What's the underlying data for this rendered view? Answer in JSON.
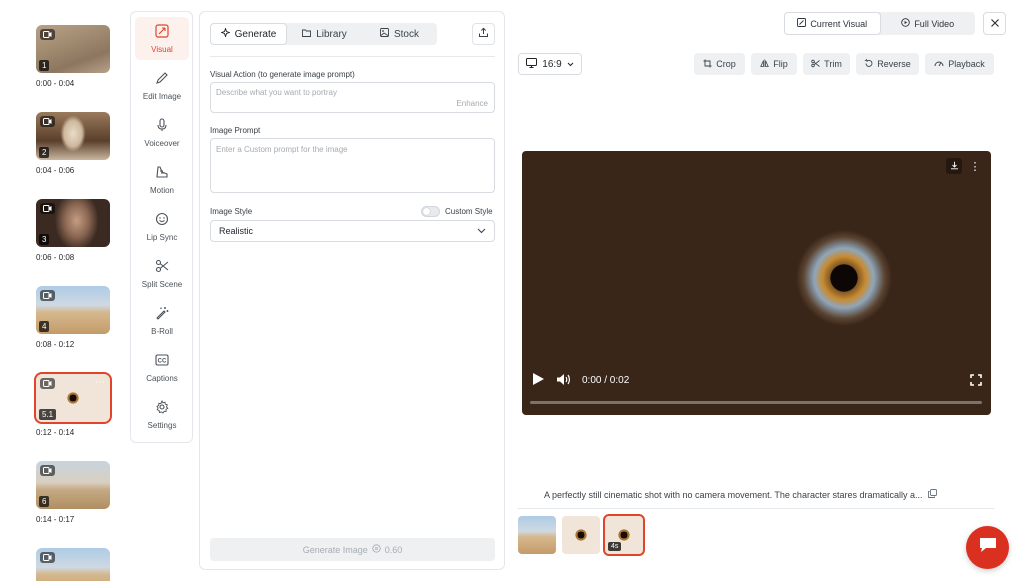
{
  "scenes": [
    {
      "number": "1",
      "time": "0:00 - 0:04",
      "image": "desert-woman-walking",
      "selected": false
    },
    {
      "number": "2",
      "time": "0:04 - 0:06",
      "image": "woman-portrait",
      "selected": false
    },
    {
      "number": "3",
      "time": "0:06 - 0:08",
      "image": "woman-face-closeup",
      "selected": false
    },
    {
      "number": "4",
      "time": "0:08 - 0:12",
      "image": "woman-in-dunes",
      "selected": false
    },
    {
      "number": "5.1",
      "time": "0:12 - 0:14",
      "image": "eye-closeup",
      "selected": true
    },
    {
      "number": "6",
      "time": "0:14 - 0:17",
      "image": "sand-dunes",
      "selected": false
    }
  ],
  "tools": [
    {
      "label": "Visual",
      "icon": "crop-frame-icon",
      "active": true
    },
    {
      "label": "Edit Image",
      "icon": "pencil-icon",
      "active": false
    },
    {
      "label": "Voiceover",
      "icon": "microphone-icon",
      "active": false
    },
    {
      "label": "Motion",
      "icon": "motion-icon",
      "active": false
    },
    {
      "label": "Lip Sync",
      "icon": "smile-icon",
      "active": false
    },
    {
      "label": "Split Scene",
      "icon": "scissors-icon",
      "active": false
    },
    {
      "label": "B-Roll",
      "icon": "magic-wand-icon",
      "active": false
    },
    {
      "label": "Captions",
      "icon": "cc-icon",
      "active": false
    },
    {
      "label": "Settings",
      "icon": "gear-icon",
      "active": false
    }
  ],
  "panel": {
    "tabs": [
      {
        "label": "Generate",
        "icon": "sparkle-icon",
        "active": true
      },
      {
        "label": "Library",
        "icon": "folder-icon",
        "active": false
      },
      {
        "label": "Stock",
        "icon": "image-icon",
        "active": false
      }
    ],
    "visual_action_label": "Visual Action (to generate image prompt)",
    "visual_action_placeholder": "Describe what you want to portray",
    "enhance_label": "Enhance",
    "image_prompt_label": "Image Prompt",
    "image_prompt_placeholder": "Enter a Custom prompt for the image",
    "image_style_label": "Image Style",
    "custom_style_label": "Custom Style",
    "custom_style_on": false,
    "style_value": "Realistic",
    "generate_label": "Generate Image",
    "generate_cost": "0.60"
  },
  "preview": {
    "view_options": [
      {
        "label": "Current Visual",
        "icon": "frame-icon",
        "active": true
      },
      {
        "label": "Full Video",
        "icon": "play-circle-icon",
        "active": false
      }
    ],
    "aspect_ratio": "16:9",
    "actions": [
      {
        "label": "Crop",
        "icon": "crop-icon"
      },
      {
        "label": "Flip",
        "icon": "flip-icon"
      },
      {
        "label": "Trim",
        "icon": "scissors-icon"
      },
      {
        "label": "Reverse",
        "icon": "reverse-icon"
      },
      {
        "label": "Playback",
        "icon": "speedometer-icon"
      }
    ],
    "time_display": "0:00 / 0:02",
    "progress": 0,
    "caption": "A perfectly still cinematic shot with no camera movement. The character stares dramatically a...",
    "variants": [
      {
        "image": "woman-in-dunes",
        "selected": false,
        "tag": ""
      },
      {
        "image": "eye-closeup",
        "selected": false,
        "tag": ""
      },
      {
        "image": "eye-closeup",
        "selected": true,
        "tag": "4s"
      }
    ]
  },
  "colors": {
    "accent": "#e0442b",
    "chat_button": "#d9301f"
  }
}
